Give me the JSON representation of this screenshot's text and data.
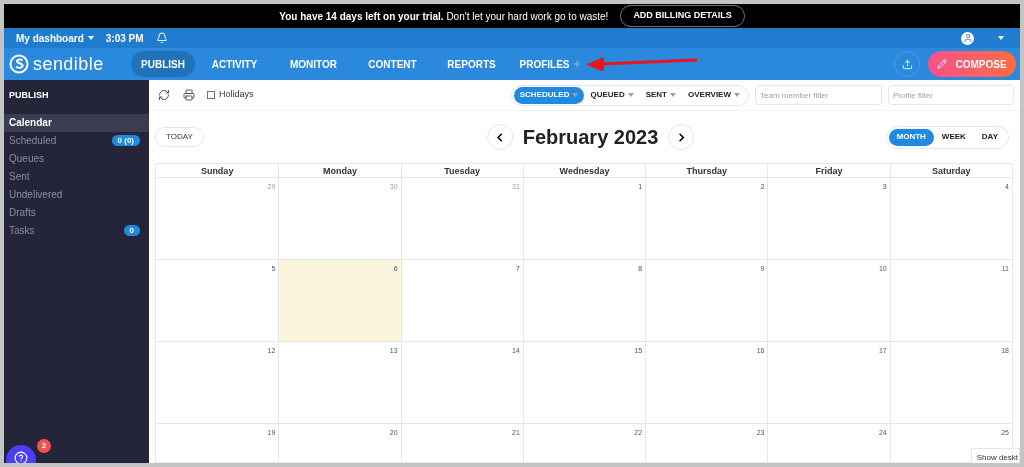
{
  "trial_banner": {
    "message": "**You have 14 days left on your trial.** Don't let your hard work go to waste!",
    "button": "ADD BILLING DETAILS"
  },
  "top_bar": {
    "dashboard": "My dashboard",
    "time": "3:03 PM"
  },
  "brand": "sendible",
  "nav": [
    {
      "label": "PUBLISH",
      "selected": true
    },
    {
      "label": "ACTIVITY",
      "selected": false
    },
    {
      "label": "MONITOR",
      "selected": false
    },
    {
      "label": "CONTENT",
      "selected": false
    },
    {
      "label": "REPORTS",
      "selected": false
    },
    {
      "label": "PROFILES",
      "selected": false
    }
  ],
  "compose": "COMPOSE",
  "sidebar": {
    "heading": "PUBLISH",
    "items": [
      {
        "label": "Calendar",
        "selected": true
      },
      {
        "label": "Scheduled",
        "selected": false,
        "badge": "0 (0)"
      },
      {
        "label": "Queues",
        "selected": false
      },
      {
        "label": "Sent",
        "selected": false
      },
      {
        "label": "Undelivered",
        "selected": false
      },
      {
        "label": "Drafts",
        "selected": false
      },
      {
        "label": "Tasks",
        "selected": false,
        "badge": "0"
      }
    ]
  },
  "toolbar": {
    "holidays": {
      "label": "Holidays",
      "checked": false
    },
    "filters": [
      {
        "label": "SCHEDULED",
        "selected": true
      },
      {
        "label": "QUEUED",
        "selected": false
      },
      {
        "label": "SENT",
        "selected": false
      },
      {
        "label": "OVERVIEW",
        "selected": false
      }
    ],
    "team_filter": {
      "placeholder": "Team member filter"
    },
    "profile_filter": {
      "placeholder": "Profile filter"
    }
  },
  "calendar": {
    "today_button": "TODAY",
    "title": "February 2023",
    "views": [
      {
        "label": "MONTH",
        "selected": true
      },
      {
        "label": "WEEK",
        "selected": false
      },
      {
        "label": "DAY",
        "selected": false
      }
    ],
    "weekdays": [
      "Sunday",
      "Monday",
      "Tuesday",
      "Wednesday",
      "Thursday",
      "Friday",
      "Saturday"
    ],
    "weeks": [
      [
        {
          "day": "29",
          "muted": true,
          "today": false
        },
        {
          "day": "30",
          "muted": true,
          "today": false
        },
        {
          "day": "31",
          "muted": true,
          "today": false
        },
        {
          "day": "1",
          "muted": false,
          "today": false
        },
        {
          "day": "2",
          "muted": false,
          "today": false
        },
        {
          "day": "3",
          "muted": false,
          "today": false
        },
        {
          "day": "4",
          "muted": false,
          "today": false
        }
      ],
      [
        {
          "day": "5",
          "muted": false,
          "today": false
        },
        {
          "day": "6",
          "muted": false,
          "today": true
        },
        {
          "day": "7",
          "muted": false,
          "today": false
        },
        {
          "day": "8",
          "muted": false,
          "today": false
        },
        {
          "day": "9",
          "muted": false,
          "today": false
        },
        {
          "day": "10",
          "muted": false,
          "today": false
        },
        {
          "day": "11",
          "muted": false,
          "today": false
        }
      ],
      [
        {
          "day": "12",
          "muted": false,
          "today": false
        },
        {
          "day": "13",
          "muted": false,
          "today": false
        },
        {
          "day": "14",
          "muted": false,
          "today": false
        },
        {
          "day": "15",
          "muted": false,
          "today": false
        },
        {
          "day": "16",
          "muted": false,
          "today": false
        },
        {
          "day": "17",
          "muted": false,
          "today": false
        },
        {
          "day": "18",
          "muted": false,
          "today": false
        }
      ],
      [
        {
          "day": "19",
          "muted": false,
          "today": false
        },
        {
          "day": "20",
          "muted": false,
          "today": false
        },
        {
          "day": "21",
          "muted": false,
          "today": false
        },
        {
          "day": "22",
          "muted": false,
          "today": false
        },
        {
          "day": "23",
          "muted": false,
          "today": false
        },
        {
          "day": "24",
          "muted": false,
          "today": false
        },
        {
          "day": "25",
          "muted": false,
          "today": false
        }
      ]
    ]
  },
  "help": {
    "badge": "2"
  },
  "tooltip": "Show deskt"
}
